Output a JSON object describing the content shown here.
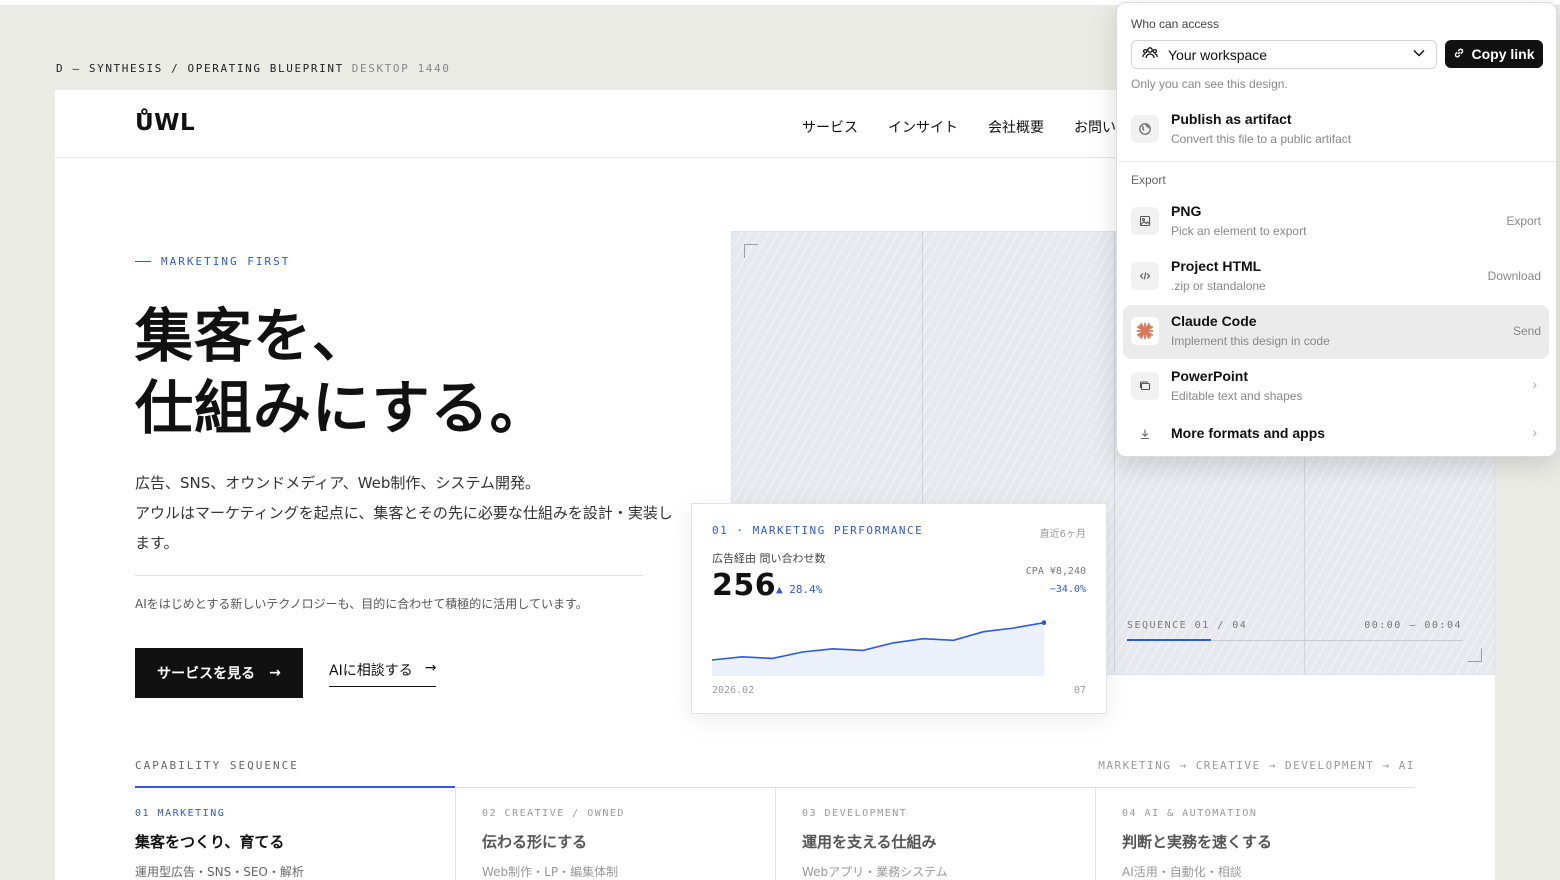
{
  "breadcrumb": {
    "path": "D — SYNTHESIS / OPERATING BLUEPRINT",
    "viewport": "DESKTOP 1440"
  },
  "header": {
    "logo": "ŮWL",
    "nav": [
      "サービス",
      "インサイト",
      "会社概要",
      "お問い合"
    ]
  },
  "hero": {
    "eyebrow": "MARKETING FIRST",
    "headline_line1": "集客を、",
    "headline_line2": "仕組みにする。",
    "body_line1": "広告、SNS、オウンドメディア、Web制作、システム開発。",
    "body_line2": "アウルはマーケティングを起点に、集客とその先に必要な仕組みを設計・実装します。",
    "ai_note": "AIをはじめとする新しいテクノロジーも、目的に合わせて積極的に活用しています。",
    "cta_primary": "サービスを見る",
    "cta_secondary": "AIに相談する",
    "arrow": "→"
  },
  "visual": {
    "sequence_label": "SEQUENCE 01 / 04",
    "sequence_time": "00:00 — 00:04",
    "sequence_progress": 0.25
  },
  "performance_card": {
    "title": "01 · MARKETING PERFORMANCE",
    "period": "直近6ヶ月",
    "subtitle": "広告経由 問い合わせ数",
    "value": "256",
    "delta": "▲ 28.4%",
    "cpa": "CPA ¥8,240",
    "cpa_delta": "−34.0%",
    "x_start": "2026.02",
    "x_end": "07",
    "accent_color": "#2d5bd7"
  },
  "chart_data": {
    "type": "area",
    "x_start": "2026.02",
    "x_end": "07",
    "values": [
      30,
      36,
      33,
      45,
      51,
      48,
      62,
      70,
      67,
      83,
      90,
      100
    ],
    "ylim": [
      0,
      120
    ],
    "grid": false
  },
  "capability": {
    "label": "CAPABILITY SEQUENCE",
    "flow": "MARKETING → CREATIVE → DEVELOPMENT → AI",
    "items": [
      {
        "num": "01 MARKETING",
        "title": "集客をつくり、育てる",
        "sub": "運用型広告・SNS・SEO・解析"
      },
      {
        "num": "02 CREATIVE / OWNED",
        "title": "伝わる形にする",
        "sub": "Web制作・LP・編集体制"
      },
      {
        "num": "03 DEVELOPMENT",
        "title": "運用を支える仕組み",
        "sub": "Webアプリ・業務システム"
      },
      {
        "num": "04 AI & AUTOMATION",
        "title": "判断と実務を速くする",
        "sub": "AI活用・自動化・相談"
      }
    ]
  },
  "share_popover": {
    "access_label": "Who can access",
    "access_value": "Your workspace",
    "copy_link": "Copy link",
    "visibility_note": "Only you can see this design.",
    "publish": {
      "name": "Publish as artifact",
      "desc": "Convert this file to a public artifact",
      "icon": "globe-icon"
    },
    "export_label": "Export",
    "export_items": [
      {
        "name": "PNG",
        "desc": "Pick an element to export",
        "action": "Export",
        "icon": "image-icon"
      },
      {
        "name": "Project HTML",
        "desc": ".zip or standalone",
        "action": "Download",
        "icon": "code-icon"
      },
      {
        "name": "Claude Code",
        "desc": "Implement this design in code",
        "action": "Send",
        "icon": "claude-icon"
      },
      {
        "name": "PowerPoint",
        "desc": "Editable text and shapes",
        "action": "›",
        "icon": "slides-icon"
      }
    ],
    "more": {
      "name": "More formats and apps",
      "action": "›",
      "icon": "download-icon"
    }
  }
}
